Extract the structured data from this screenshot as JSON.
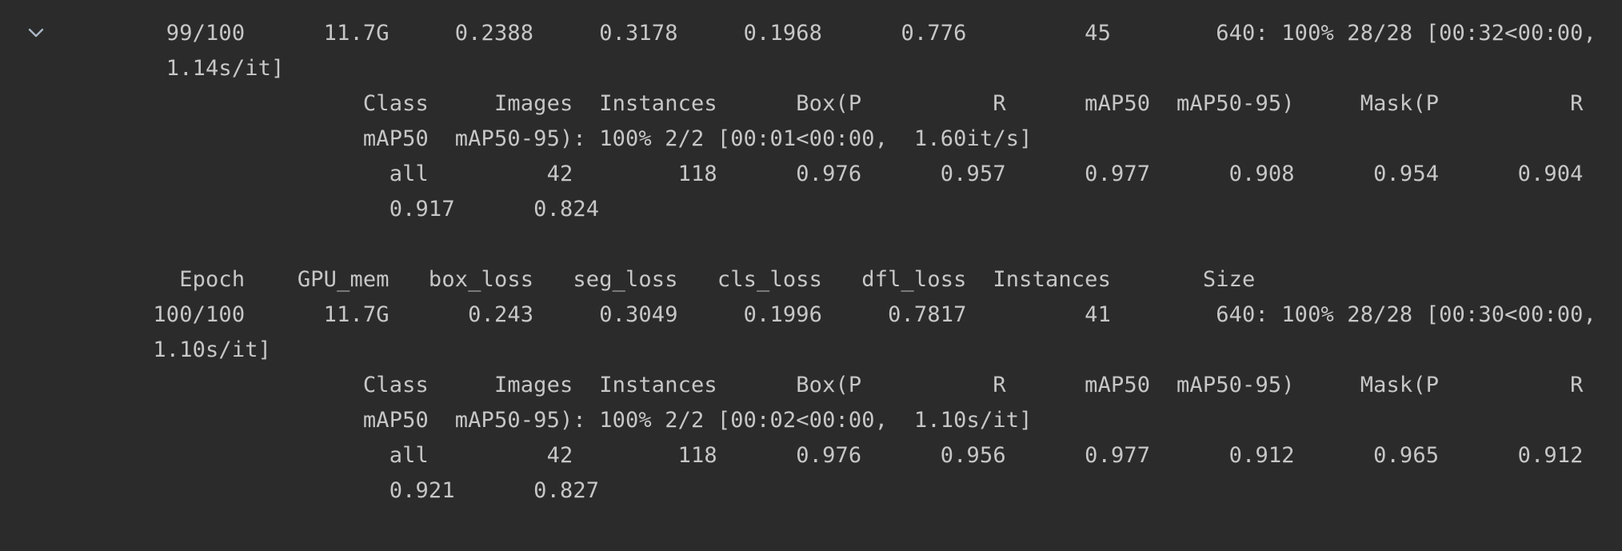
{
  "toggle": {
    "icon": "chevron-down-icon",
    "color": "#a9b7c6"
  },
  "colors": {
    "background": "#2b2b2b",
    "text": "#c7c7c7"
  },
  "log": {
    "lines": [
      "  99/100      11.7G     0.2388     0.3178     0.1968      0.776         45        640: 100% 28/28 [00:32<00:00,",
      "  1.14s/it]",
      "                 Class     Images  Instances      Box(P          R      mAP50  mAP50-95)     Mask(P          R",
      "                 mAP50  mAP50-95): 100% 2/2 [00:01<00:00,  1.60it/s]",
      "                   all         42        118      0.976      0.957      0.977      0.908      0.954      0.904",
      "                   0.917      0.824",
      "",
      "   Epoch    GPU_mem   box_loss   seg_loss   cls_loss   dfl_loss  Instances       Size",
      " 100/100      11.7G      0.243     0.3049     0.1996     0.7817         41        640: 100% 28/28 [00:30<00:00,",
      " 1.10s/it]",
      "                 Class     Images  Instances      Box(P          R      mAP50  mAP50-95)     Mask(P          R",
      "                 mAP50  mAP50-95): 100% 2/2 [00:02<00:00,  1.10s/it]",
      "                   all         42        118      0.976      0.956      0.977      0.912      0.965      0.912",
      "                   0.921      0.827"
    ]
  }
}
